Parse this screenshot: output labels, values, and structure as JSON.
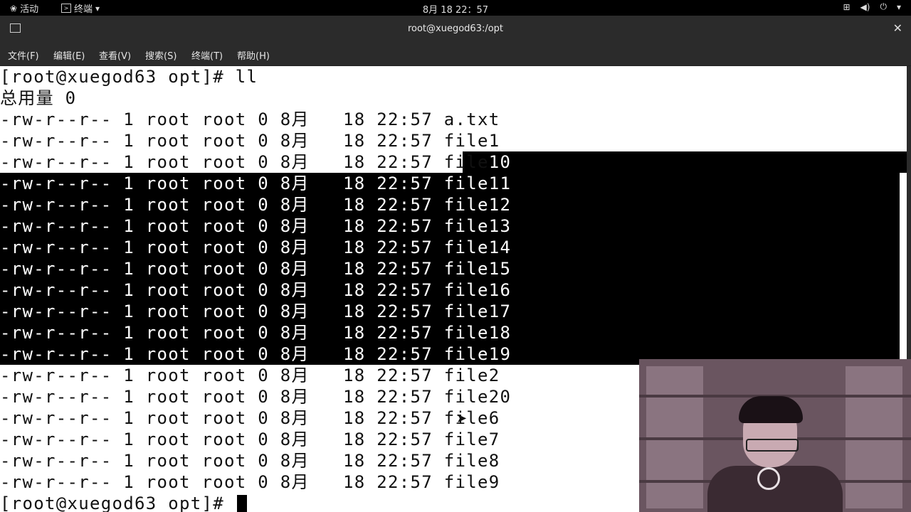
{
  "topbar": {
    "activities_label": "活动",
    "terminal_menu_label": "终端",
    "clock": "8月 18 22：57"
  },
  "window": {
    "title": "root@xuegod63:/opt"
  },
  "menu": {
    "items": [
      "文件(F)",
      "编辑(E)",
      "查看(V)",
      "搜索(S)",
      "终端(T)",
      "帮助(H)"
    ]
  },
  "terminal": {
    "prompt_command": "[root@xuegod63 opt]# ll",
    "total": "总用量 0",
    "listing_prefix": "-rw-r--r-- 1 root root 0 8月   18 22:57 ",
    "files": [
      "a.txt",
      "file1",
      "file10",
      "file11",
      "file12",
      "file13",
      "file14",
      "file15",
      "file16",
      "file17",
      "file18",
      "file19",
      "file2",
      "file20",
      "file6",
      "file7",
      "file8",
      "file9"
    ],
    "final_prompt": "[root@xuegod63 opt]# "
  }
}
